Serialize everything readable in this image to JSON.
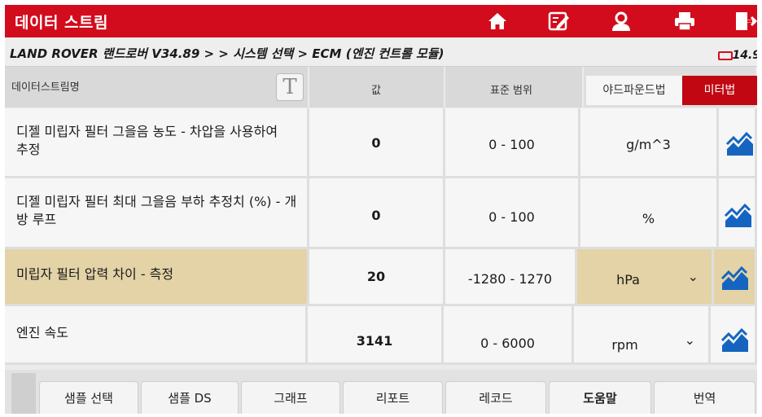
{
  "titlebar": {
    "title": "데이터 스트림",
    "accent": "#d20c1d",
    "buttons": [
      "home-icon",
      "edit-icon",
      "user-icon",
      "printer-icon",
      "exit-icon"
    ]
  },
  "breadcrumb": {
    "path": "LAND ROVER 랜드로버 V34.89 > > 시스템 선택 > ECM (엔진 컨트롤 모듈)",
    "battery": "14.9"
  },
  "header": {
    "name_col": "데이터스트림명",
    "value_col": "값",
    "range_col": "표준 범위",
    "unit_imperial": "야드파운드법",
    "unit_metric": "미터법"
  },
  "rows": [
    {
      "name": "디젤 미립자 필터 그을음 농도 - 차압을 사용하여 추정",
      "value": "0",
      "range": "0 - 100",
      "unit": "g/m^3"
    },
    {
      "name": "디젤 미립자 필터 최대 그을음 부하 추정치 (%) - 개방 루프",
      "value": "0",
      "range": "0 - 100",
      "unit": "%"
    },
    {
      "name": "미립자 필터 압력 차이 - 측정",
      "value": "20",
      "range": "-1280 - 1270",
      "unit": "hPa"
    },
    {
      "name": "엔진 속도",
      "value": "3141",
      "range": "0 - 6000",
      "unit": "rpm"
    }
  ],
  "tabs": [
    "샘플 선택",
    "샘플 DS",
    "그래프",
    "리포트",
    "레코드",
    "도움말",
    "번역"
  ]
}
